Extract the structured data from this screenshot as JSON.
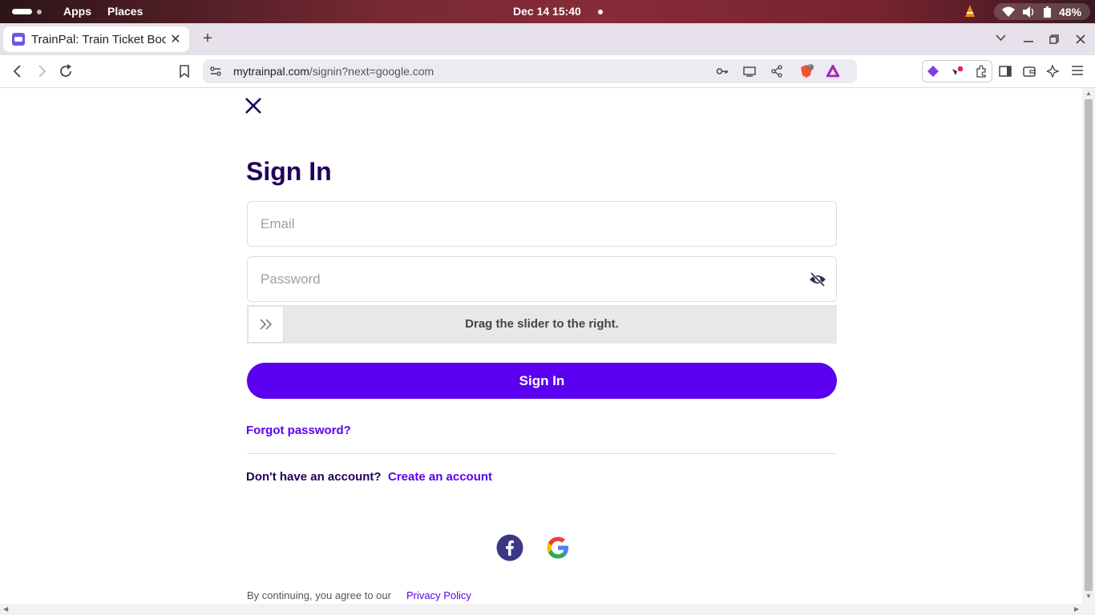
{
  "system_bar": {
    "apps_label": "Apps",
    "places_label": "Places",
    "clock": "Dec 14  15:40",
    "battery": "48%"
  },
  "browser": {
    "tab_title": "TrainPal: Train Ticket Booking",
    "url_domain": "mytrainpal.com",
    "url_path": "/signin?next=google.com",
    "brave_badge": "7"
  },
  "signin": {
    "heading": "Sign In",
    "email_placeholder": "Email",
    "password_placeholder": "Password",
    "slider_text": "Drag the slider to the right.",
    "submit_label": "Sign In",
    "forgot_label": "Forgot password?",
    "no_account_text": "Don't have an account?",
    "create_account_label": "Create an account",
    "terms_text": "By continuing, you agree to our",
    "privacy_label": "Privacy Policy"
  },
  "colors": {
    "brand_purple": "#5b00f0",
    "heading_navy": "#21005b"
  },
  "icons": [
    "close-icon",
    "eye-off-icon",
    "double-chevron-right-icon",
    "facebook-icon",
    "google-icon"
  ]
}
